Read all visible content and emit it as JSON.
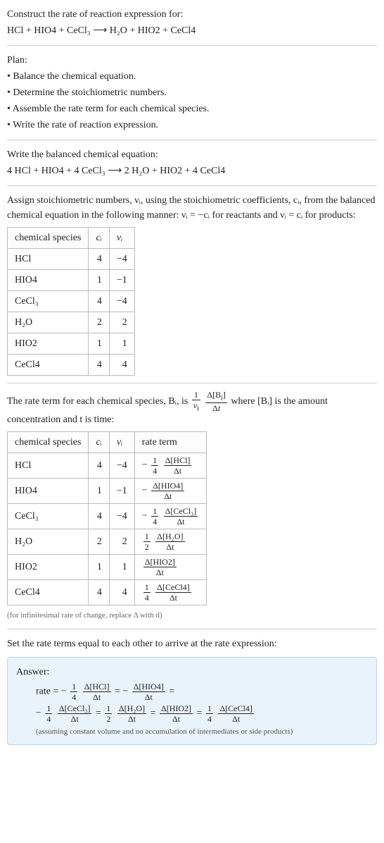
{
  "intro": {
    "title": "Construct the rate of reaction expression for:",
    "equation": "HCl + HIO4 + CeCl₃  ⟶  H₂O + HIO2 + CeCl4"
  },
  "plan": {
    "title": "Plan:",
    "items": [
      "• Balance the chemical equation.",
      "• Determine the stoichiometric numbers.",
      "• Assemble the rate term for each chemical species.",
      "• Write the rate of reaction expression."
    ]
  },
  "balanced": {
    "title": "Write the balanced chemical equation:",
    "equation": "4 HCl + HIO4 + 4 CeCl₃  ⟶  2 H₂O + HIO2 + 4 CeCl4"
  },
  "stoich_intro": "Assign stoichiometric numbers, νᵢ, using the stoichiometric coefficients, cᵢ, from the balanced chemical equation in the following manner: νᵢ = −cᵢ for reactants and νᵢ = cᵢ for products:",
  "table1": {
    "headers": [
      "chemical species",
      "cᵢ",
      "νᵢ"
    ],
    "rows": [
      {
        "species": "HCl",
        "c": "4",
        "v": "−4"
      },
      {
        "species": "HIO4",
        "c": "1",
        "v": "−1"
      },
      {
        "species": "CeCl₃",
        "c": "4",
        "v": "−4"
      },
      {
        "species": "H₂O",
        "c": "2",
        "v": "2"
      },
      {
        "species": "HIO2",
        "c": "1",
        "v": "1"
      },
      {
        "species": "CeCl4",
        "c": "4",
        "v": "4"
      }
    ]
  },
  "rateterm_intro_pre": "The rate term for each chemical species, Bᵢ, is ",
  "rateterm_intro_post": " where [Bᵢ] is the amount concentration and t is time:",
  "table2": {
    "headers": [
      "chemical species",
      "cᵢ",
      "νᵢ",
      "rate term"
    ],
    "rows": [
      {
        "species": "HCl",
        "c": "4",
        "v": "−4",
        "neg": "− ",
        "coefNum": "1",
        "coefDen": "4",
        "dNum": "Δ[HCl]",
        "dDen": "Δt"
      },
      {
        "species": "HIO4",
        "c": "1",
        "v": "−1",
        "neg": "− ",
        "coefNum": "",
        "coefDen": "",
        "dNum": "Δ[HIO4]",
        "dDen": "Δt"
      },
      {
        "species": "CeCl₃",
        "c": "4",
        "v": "−4",
        "neg": "− ",
        "coefNum": "1",
        "coefDen": "4",
        "dNum": "Δ[CeCl₃]",
        "dDen": "Δt"
      },
      {
        "species": "H₂O",
        "c": "2",
        "v": "2",
        "neg": "",
        "coefNum": "1",
        "coefDen": "2",
        "dNum": "Δ[H₂O]",
        "dDen": "Δt"
      },
      {
        "species": "HIO2",
        "c": "1",
        "v": "1",
        "neg": "",
        "coefNum": "",
        "coefDen": "",
        "dNum": "Δ[HIO2]",
        "dDen": "Δt"
      },
      {
        "species": "CeCl4",
        "c": "4",
        "v": "4",
        "neg": "",
        "coefNum": "1",
        "coefDen": "4",
        "dNum": "Δ[CeCl4]",
        "dDen": "Δt"
      }
    ]
  },
  "table2_note": "(for infinitesimal rate of change, replace Δ with d)",
  "final_intro": "Set the rate terms equal to each other to arrive at the rate expression:",
  "answer": {
    "label": "Answer:",
    "prefix": "rate = ",
    "eq": " = ",
    "terms": [
      {
        "neg": "− ",
        "coefNum": "1",
        "coefDen": "4",
        "dNum": "Δ[HCl]",
        "dDen": "Δt"
      },
      {
        "neg": "− ",
        "coefNum": "",
        "coefDen": "",
        "dNum": "Δ[HIO4]",
        "dDen": "Δt"
      },
      {
        "neg": "− ",
        "coefNum": "1",
        "coefDen": "4",
        "dNum": "Δ[CeCl₃]",
        "dDen": "Δt"
      },
      {
        "neg": "",
        "coefNum": "1",
        "coefDen": "2",
        "dNum": "Δ[H₂O]",
        "dDen": "Δt"
      },
      {
        "neg": "",
        "coefNum": "",
        "coefDen": "",
        "dNum": "Δ[HIO2]",
        "dDen": "Δt"
      },
      {
        "neg": "",
        "coefNum": "1",
        "coefDen": "4",
        "dNum": "Δ[CeCl4]",
        "dDen": "Δt"
      }
    ],
    "note": "(assuming constant volume and no accumulation of intermediates or side products)"
  }
}
